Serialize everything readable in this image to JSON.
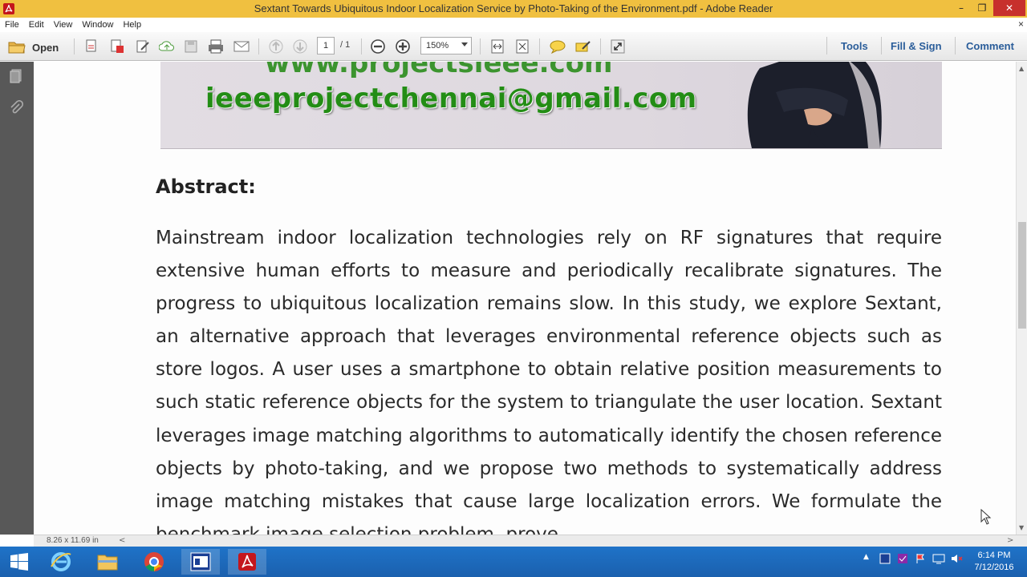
{
  "window": {
    "title": "Sextant Towards Ubiquitous Indoor Localization Service by Photo-Taking of the Environment.pdf - Adobe Reader",
    "minimize": "–",
    "restore": "❐",
    "close": "✕"
  },
  "menu": {
    "items": [
      "File",
      "Edit",
      "View",
      "Window",
      "Help"
    ],
    "close_doc": "×"
  },
  "toolbar": {
    "open_label": "Open",
    "page_current": "1",
    "page_total": "/ 1",
    "zoom": "150%",
    "tools_label": "Tools",
    "fill_sign_label": "Fill & Sign",
    "comment_label": "Comment"
  },
  "document": {
    "banner_top_text": "www.projectsieee.com",
    "banner_email": "ieeeprojectchennai@gmail.com",
    "abstract_heading": "Abstract:",
    "abstract_body": "Mainstream indoor localization technologies rely on RF signatures that require extensive human efforts to measure and periodically recalibrate signatures. The progress to ubiquitous localization remains slow. In this study, we explore Sextant, an alternative approach that leverages environmental reference objects such as store logos. A user uses a smartphone to obtain relative position measurements to such static reference objects for the system to triangulate the user location. Sextant leverages image matching algorithms to automatically identify the chosen reference objects by photo-taking, and we propose two methods to systematically address image matching mistakes that cause large localization errors. We formulate the benchmark image selection problem, prove"
  },
  "statusbar": {
    "page_size": "8.26 x 11.69 in",
    "scroll_left": "<",
    "scroll_right": ">"
  },
  "taskbar": {
    "time": "6:14 PM",
    "date": "7/12/2016"
  },
  "colors": {
    "titlebar": "#f0c040",
    "accent_link": "#2a5d9a",
    "banner_green": "#238d15",
    "taskbar": "#1f73c8"
  }
}
